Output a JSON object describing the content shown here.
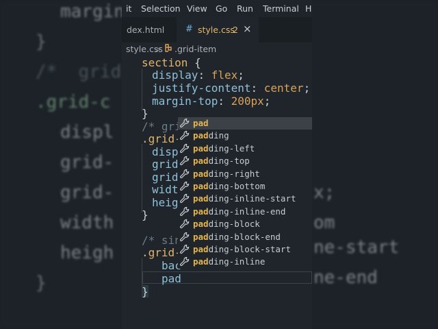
{
  "menu": [
    "it",
    "Selection",
    "View",
    "Go",
    "Run",
    "Terminal",
    "H"
  ],
  "tabs": {
    "inactive": "dex.html",
    "active": {
      "icon": "#",
      "name": "style.css",
      "problems": "2",
      "close": "×"
    }
  },
  "breadcrumb": {
    "file": "style.css",
    "separator": ">",
    "symbol": ".grid-item"
  },
  "code": {
    "l1_sel": "section",
    "l1_brace": "{",
    "l2_prop": "display",
    "l2_val": "flex",
    "l3_prop": "justify-content",
    "l3_val": "center",
    "l4_prop": "margin-top",
    "l4_num": "200px",
    "l5": "}",
    "l6": "/* grid",
    "l7": ".grid-c",
    "l8": "displ",
    "l9": "grid-",
    "l10": "grid-",
    "l11": "width",
    "l12": "heigh",
    "l13": "}",
    "l14": "/* sing",
    "l15": ".grid-i",
    "l16": "bac",
    "l17": "pad",
    "l18": "}"
  },
  "suggestions": {
    "typed": "pad",
    "items": [
      {
        "match": "pad",
        "rest": ""
      },
      {
        "match": "pad",
        "rest": "ding"
      },
      {
        "match": "pad",
        "rest": "ding-left"
      },
      {
        "match": "pad",
        "rest": "ding-top"
      },
      {
        "match": "pad",
        "rest": "ding-right"
      },
      {
        "match": "pad",
        "rest": "ding-bottom"
      },
      {
        "match": "pad",
        "rest": "ding-inline-start"
      },
      {
        "match": "pad",
        "rest": "ding-inline-end"
      },
      {
        "match": "pad",
        "rest": "ding-block"
      },
      {
        "match": "pad",
        "rest": "ding-block-end"
      },
      {
        "match": "pad",
        "rest": "ding-block-start"
      },
      {
        "match": "pad",
        "rest": "ding-inline"
      }
    ]
  },
  "background": {
    "b1": "margin",
    "b2": "}",
    "b3": "/*  grid",
    "b4": ".grid-c",
    "b5": "displ",
    "b6": "grid-",
    "b7": "grid-",
    "b8": "width",
    "b9": "heigh",
    "b10": "}",
    "r1": "x;",
    "r2": "om",
    "r3": "ne-start",
    "r4": "ne-end"
  },
  "colors": {
    "accent": "#e8b64e",
    "selector": "#e0b46c",
    "property": "#8fc1d9",
    "comment": "#6a7b87",
    "panel": "#1f252a"
  }
}
